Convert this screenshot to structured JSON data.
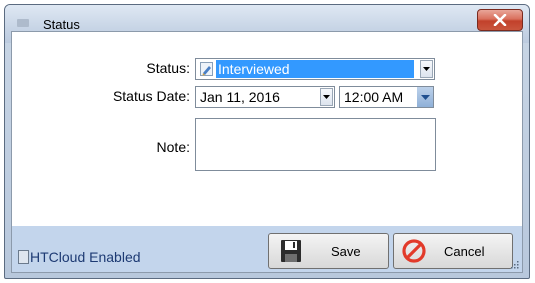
{
  "window": {
    "title": "Status"
  },
  "form": {
    "status_label": "Status:",
    "status_value": "Interviewed",
    "status_date_label": "Status Date:",
    "date_value": "Jan 11, 2016",
    "time_value": "12:00 AM",
    "note_label": "Note:",
    "note_value": ""
  },
  "footer": {
    "htcloud_text": "HTCloud Enabled",
    "save_label": "Save",
    "cancel_label": "Cancel"
  },
  "colors": {
    "selection": "#3399ff",
    "footer_bg": "#c3d5ec",
    "close_red": "#c9553d",
    "cancel_red": "#e23a2a"
  }
}
